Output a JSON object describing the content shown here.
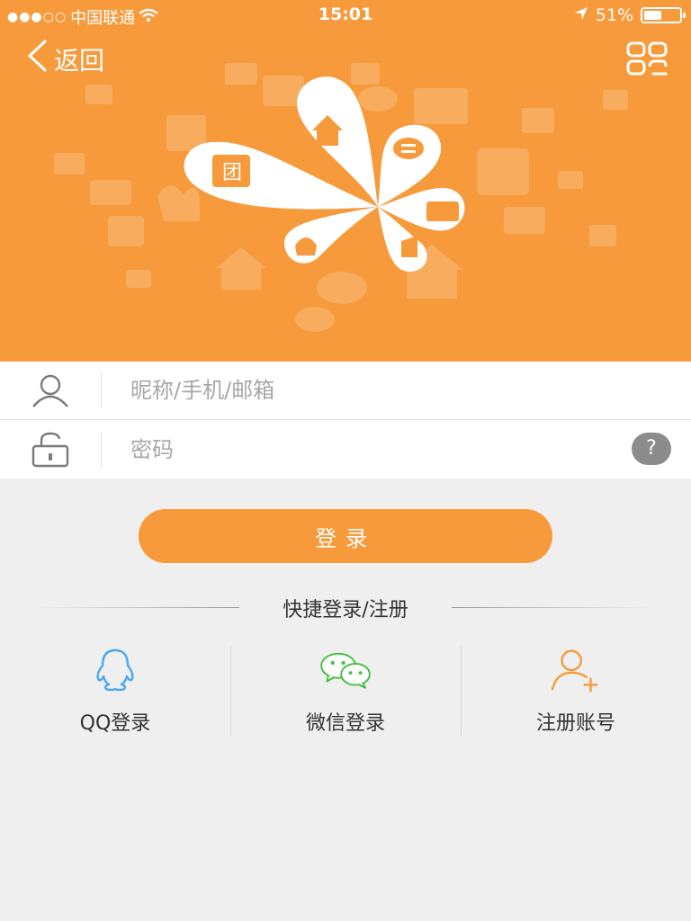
{
  "status_bar": {
    "signal": "●●●○○",
    "carrier": "中国联通",
    "time": "15:01",
    "battery_text": "51%",
    "battery_level": 0.51
  },
  "nav": {
    "back_label": "返回",
    "back_icon": "chevron-left-icon",
    "menu_icon": "grid-menu-icon"
  },
  "form": {
    "username_placeholder": "昵称/手机/邮箱",
    "password_placeholder": "密码",
    "help_label": "?"
  },
  "login_button": "登录",
  "quick_login": {
    "title": "快捷登录/注册",
    "options": [
      {
        "label": "QQ登录",
        "icon": "qq-icon",
        "color": "#4aa8ef"
      },
      {
        "label": "微信登录",
        "icon": "wechat-icon",
        "color": "#3fbf3f"
      },
      {
        "label": "注册账号",
        "icon": "add-user-icon",
        "color": "#f79a3b"
      }
    ]
  },
  "colors": {
    "accent": "#f79a3b",
    "background": "#efefef"
  },
  "illustration": {
    "badge_text": "团"
  }
}
